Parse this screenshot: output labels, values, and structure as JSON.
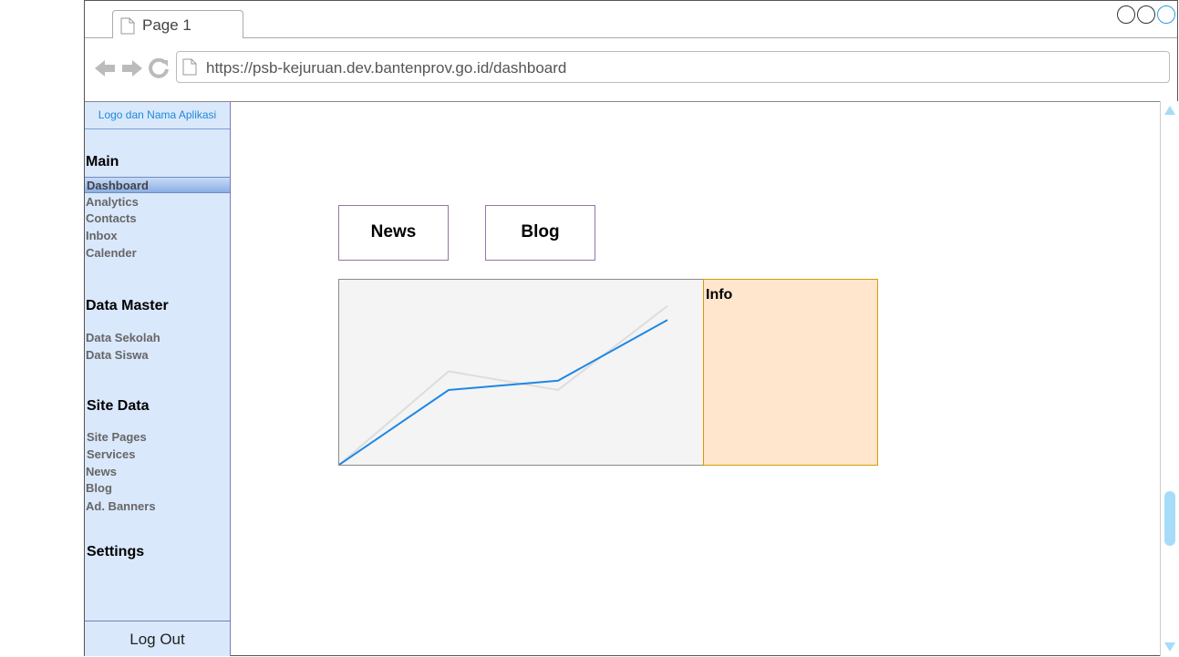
{
  "browser": {
    "tab_title": "Page 1",
    "url": "https://psb-kejuruan.dev.bantenprov.go.id/dashboard"
  },
  "sidebar": {
    "logo_text": "Logo dan Nama Aplikasi",
    "sections": {
      "main": {
        "title": "Main",
        "items": [
          "Dashboard",
          "Analytics",
          "Contacts",
          "Inbox",
          "Calender"
        ]
      },
      "data_master": {
        "title": "Data Master",
        "items": [
          "Data Sekolah",
          "Data Siswa"
        ]
      },
      "site_data": {
        "title": "Site Data",
        "items": [
          "Site Pages",
          "Services",
          "News",
          "Blog",
          "Ad. Banners"
        ]
      },
      "settings": {
        "title": "Settings"
      }
    },
    "active_item": "Dashboard",
    "logout_label": "Log Out"
  },
  "content": {
    "buttons": [
      "News",
      "Blog"
    ],
    "info_title": "Info"
  },
  "chart_data": {
    "type": "line",
    "x": [
      0,
      1,
      2,
      3
    ],
    "series": [
      {
        "values": [
          0,
          1.0,
          0.8,
          1.7
        ],
        "color": "#dddddd"
      },
      {
        "values": [
          0,
          0.8,
          0.9,
          1.55
        ],
        "color": "#1e88e5"
      }
    ],
    "ylim": [
      0,
      2
    ],
    "grid": false
  },
  "colors": {
    "sidebar_bg": "#dae8fc",
    "info_bg": "#ffe6cc",
    "accent_blue": "#1e88e5"
  }
}
